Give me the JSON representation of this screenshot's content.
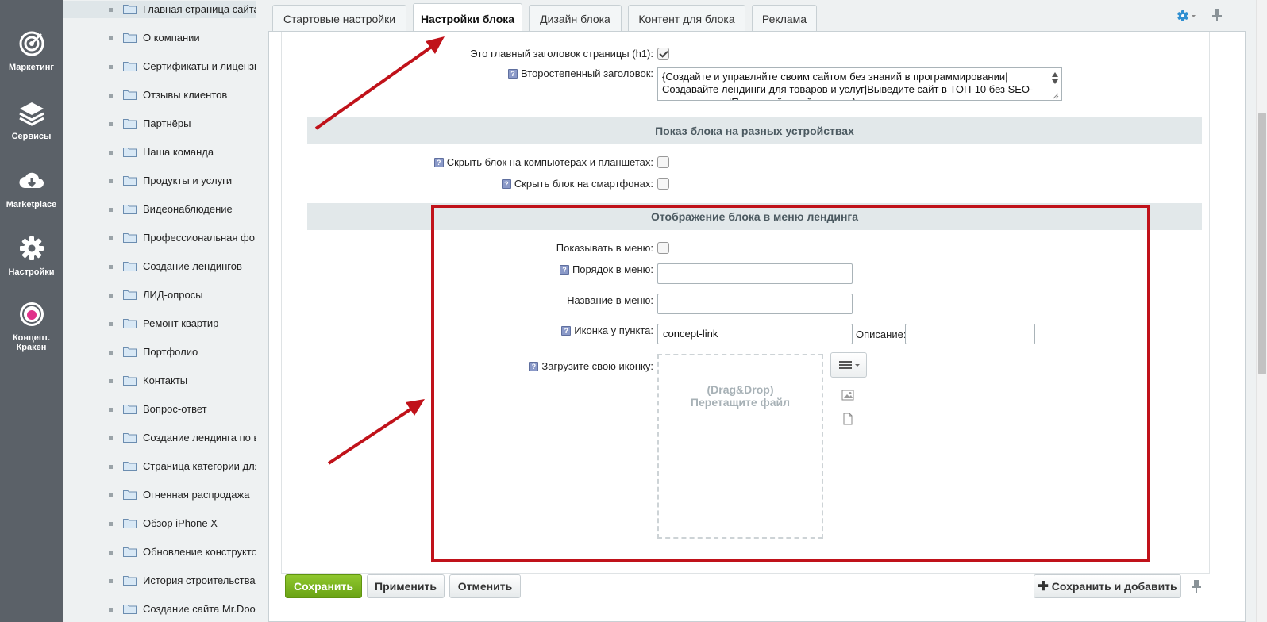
{
  "leftnav": {
    "items": [
      {
        "label": "Маркетинг",
        "icon": "target-icon"
      },
      {
        "label": "Сервисы",
        "icon": "layers-icon"
      },
      {
        "label": "Marketplace",
        "icon": "cloud-download-icon"
      },
      {
        "label": "Настройки",
        "icon": "gear-icon"
      },
      {
        "label": "Концепт. Кракен",
        "icon": "kraken-logo-icon"
      }
    ]
  },
  "tree": {
    "items": [
      "Главная страница сайта",
      "О компании",
      "Сертификаты и лицензии",
      "Отзывы клиентов",
      "Партнёры",
      "Наша команда",
      "Продукты и услуги",
      "Видеонаблюдение",
      "Профессиональная фото",
      "Создание лендингов",
      "ЛИД-опросы",
      "Ремонт квартир",
      "Портфолио",
      "Контакты",
      "Вопрос-ответ",
      "Создание лендинга по в",
      "Страница категории для",
      "Огненная распродажа",
      "Обзор iPhone X",
      "Обновление конструкто",
      "История строительства",
      "Создание сайта Mr.Door"
    ]
  },
  "tabs": [
    "Стартовые настройки",
    "Настройки блока",
    "Дизайн блока",
    "Контент для блока",
    "Реклама"
  ],
  "form": {
    "h1_label": "Это главный заголовок страницы (h1):",
    "h1_checked": true,
    "subtitle_label": "Второстепенный заголовок:",
    "subtitle_value": "{Создайте и управляйте своим сайтом без знаний в программировании|Создавайте лендинги для товаров и услуг|Выведите сайт в ТОП-10 без SEO-специалистов|Продвигайте сайт сами...}",
    "section_devices": "Показ блока на разных устройствах",
    "hide_desktop_label": "Скрыть блок на компьютерах и планшетах:",
    "hide_mobile_label": "Скрыть блок на смартфонах:",
    "section_menu": "Отображение блока в меню лендинга",
    "show_in_menu_label": "Показывать в меню:",
    "menu_order_label": "Порядок в меню:",
    "menu_order_value": "",
    "menu_name_label": "Название в меню:",
    "menu_name_value": "",
    "icon_label": "Иконка у пункта:",
    "icon_value": "concept-link",
    "description_label": "Описание:",
    "description_value": "",
    "upload_label": "Загрузите свою иконку:",
    "drop_line1": "(Drag&Drop)",
    "drop_line2": "Перетащите файл"
  },
  "help_glyph": "?",
  "buttons": {
    "save": "Сохранить",
    "apply": "Применить",
    "cancel": "Отменить",
    "save_add": "Сохранить и добавить"
  },
  "colors": {
    "annotation_red": "#c0121a",
    "save_green": "#7ab51d",
    "nav_bg": "#5b6168"
  }
}
